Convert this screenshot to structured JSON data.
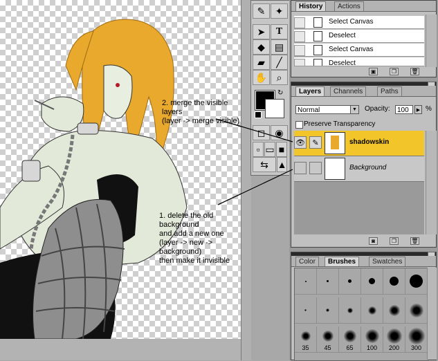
{
  "history": {
    "tabs": [
      "History",
      "Actions"
    ],
    "active_tab": "History",
    "items": [
      "Select Canvas",
      "Deselect",
      "Select Canvas",
      "Deselect"
    ]
  },
  "layers": {
    "tabs": [
      "Layers",
      "Channels",
      "Paths"
    ],
    "active_tab": "Layers",
    "blend_mode": "Normal",
    "opacity_label": "Opacity:",
    "opacity_value": "100",
    "opacity_unit": "%",
    "preserve_transparency": "Preserve Transparency",
    "items": [
      {
        "name": "shadowskin",
        "selected": true,
        "visible": true
      },
      {
        "name": "Background",
        "selected": false,
        "visible": false
      }
    ]
  },
  "brushes": {
    "tabs": [
      "Color",
      "Brushes",
      "Swatches"
    ],
    "active_tab": "Brushes",
    "size_labels": [
      "35",
      "45",
      "65",
      "100",
      "200",
      "300"
    ]
  },
  "annotations": {
    "step2": [
      "2. merge the visible layers",
      "(layer -> merge visible)"
    ],
    "step1": [
      "1. delete the old background",
      "and add a new one",
      "(layer -> new -> background)",
      "then make it invisible"
    ]
  },
  "colors": {
    "selected_layer": "#f2c62a",
    "titlebar": "#2a2a2a"
  }
}
